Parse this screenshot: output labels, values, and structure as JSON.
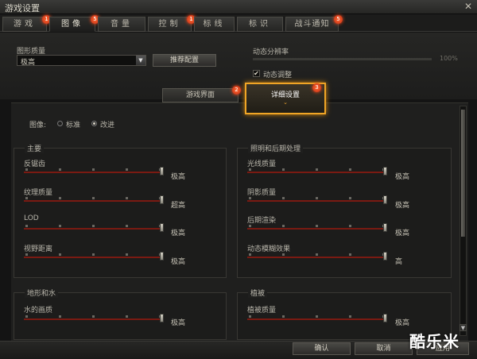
{
  "window": {
    "title": "游戏设置",
    "close": "✕"
  },
  "tabs": [
    {
      "label": "游戏",
      "badge": "1"
    },
    {
      "label": "图像",
      "badge": "5"
    },
    {
      "label": "音量",
      "badge": ""
    },
    {
      "label": "控制",
      "badge": "1"
    },
    {
      "label": "标线",
      "badge": ""
    },
    {
      "label": "标识",
      "badge": ""
    },
    {
      "label": "战斗通知",
      "badge": "5"
    }
  ],
  "graphics": {
    "quality_label": "图形质量",
    "quality_value": "极高",
    "recommend_button": "推荐配置",
    "dynamic_resolution_label": "动态分辨率",
    "dynamic_resolution_value": "100%",
    "dynamic_resolution_fraction": 0.0,
    "dynamic_adjust_label": "动态调整",
    "dynamic_adjust_checked": true
  },
  "subtabs": [
    {
      "label": "游戏界面",
      "badge": "2"
    },
    {
      "label": "详细设置",
      "badge": "3",
      "chevron": "⌄"
    }
  ],
  "image_mode": {
    "label": "图像:",
    "options": [
      "标准",
      "改进"
    ],
    "selected": "改进"
  },
  "groups": {
    "main": {
      "title": "主要",
      "sliders": [
        {
          "label": "反锯齿",
          "value": "极高",
          "level": 1.0
        },
        {
          "label": "纹理质量",
          "value": "超高",
          "level": 1.0
        },
        {
          "label": "LOD",
          "value": "极高",
          "level": 1.0
        },
        {
          "label": "视野距离",
          "value": "极高",
          "level": 1.0
        }
      ]
    },
    "lighting": {
      "title": "照明和后期处理",
      "sliders": [
        {
          "label": "光线质量",
          "value": "极高",
          "level": 1.0
        },
        {
          "label": "阴影质量",
          "value": "极高",
          "level": 1.0
        },
        {
          "label": "后期渲染",
          "value": "极高",
          "level": 1.0
        },
        {
          "label": "动态模糊效果",
          "value": "高",
          "level": 1.0
        }
      ]
    },
    "terrain": {
      "title": "地形和水",
      "sliders": [
        {
          "label": "水的画质",
          "value": "极高",
          "level": 1.0
        }
      ]
    },
    "vegetation": {
      "title": "植被",
      "sliders": [
        {
          "label": "植被质量",
          "value": "极高",
          "level": 1.0
        }
      ]
    }
  },
  "footer": {
    "ok": "确认",
    "cancel": "取消",
    "apply": "应用"
  },
  "watermark": "酷乐米"
}
